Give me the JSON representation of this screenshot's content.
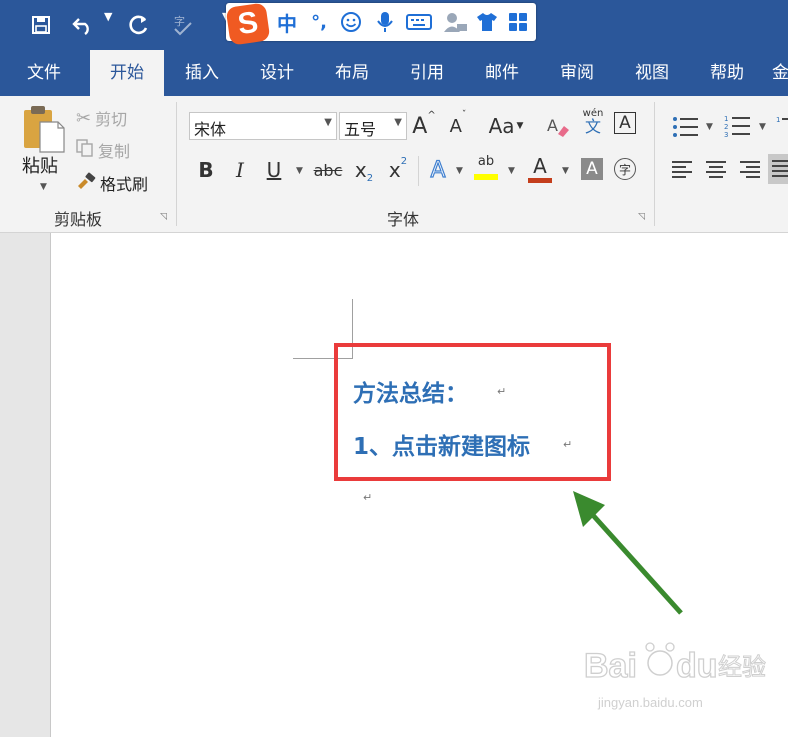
{
  "quick_access": {
    "save_icon": "save-icon",
    "undo_icon": "undo-icon",
    "redo_icon": "redo-icon",
    "spell_icon": "spelling-icon"
  },
  "ime": {
    "logo": "S",
    "mode": "中",
    "punct": "°,"
  },
  "tabs": [
    {
      "label": "文件",
      "active": false
    },
    {
      "label": "开始",
      "active": true
    },
    {
      "label": "插入",
      "active": false
    },
    {
      "label": "设计",
      "active": false
    },
    {
      "label": "布局",
      "active": false
    },
    {
      "label": "引用",
      "active": false
    },
    {
      "label": "邮件",
      "active": false
    },
    {
      "label": "审阅",
      "active": false
    },
    {
      "label": "视图",
      "active": false
    },
    {
      "label": "帮助",
      "active": false
    },
    {
      "label": "金",
      "active": false
    }
  ],
  "clipboard": {
    "group_label": "剪贴板",
    "paste": "粘贴",
    "cut": "剪切",
    "copy": "复制",
    "format_painter": "格式刷"
  },
  "font": {
    "group_label": "字体",
    "font_name": "宋体",
    "font_size": "五号",
    "change_case": "Aa",
    "phonetic_top": "wén",
    "phonetic_bottom": "文",
    "bold": "B",
    "italic": "I",
    "underline": "U",
    "strike": "abc",
    "subscript": "x",
    "subscript_sub": "2",
    "superscript": "x",
    "superscript_sup": "2",
    "highlight": "ab",
    "font_color": "A",
    "char_shading": "A",
    "enclose": "字",
    "grow": "A",
    "shrink": "A",
    "text_effect": "A",
    "char_border": "A"
  },
  "document": {
    "line1": "方法总结：",
    "line2": "1、点击新建图标",
    "return_mark": "↵"
  },
  "watermark": {
    "brand": "Baidu",
    "brand_cn": "经验",
    "url": "jingyan.baidu.com"
  },
  "colors": {
    "title_blue": "#2b579a",
    "doc_text": "#2e6fb5",
    "highlight_box": "#ea3b3b",
    "arrow": "#3a8a2e",
    "highlight_yellow": "#ffff00",
    "font_color_red": "#c43e1c"
  }
}
